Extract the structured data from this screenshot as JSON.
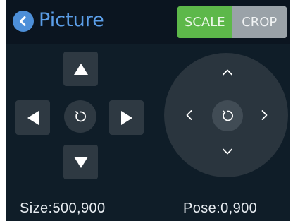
{
  "header": {
    "title": "Picture",
    "back_icon": "chevron-left-icon"
  },
  "mode": {
    "scale_label": "SCALE",
    "crop_label": "CROP",
    "active": "SCALE"
  },
  "colors": {
    "background": "#0f1d28",
    "accent_blue": "#5b9ee8",
    "active_green": "#5db84a",
    "inactive_gray": "#9aa2a8",
    "button_bg": "#2e3942"
  },
  "dpad": {
    "up_icon": "triangle-up-icon",
    "down_icon": "triangle-down-icon",
    "left_icon": "triangle-left-icon",
    "right_icon": "triangle-right-icon",
    "center_icon": "reset-icon"
  },
  "joystick": {
    "up_icon": "chevron-up-icon",
    "down_icon": "chevron-down-icon",
    "left_icon": "chevron-left-icon",
    "right_icon": "chevron-right-icon",
    "center_icon": "reset-icon"
  },
  "status": {
    "size_text": "Size:500,900",
    "pose_text": "Pose:0,900"
  }
}
